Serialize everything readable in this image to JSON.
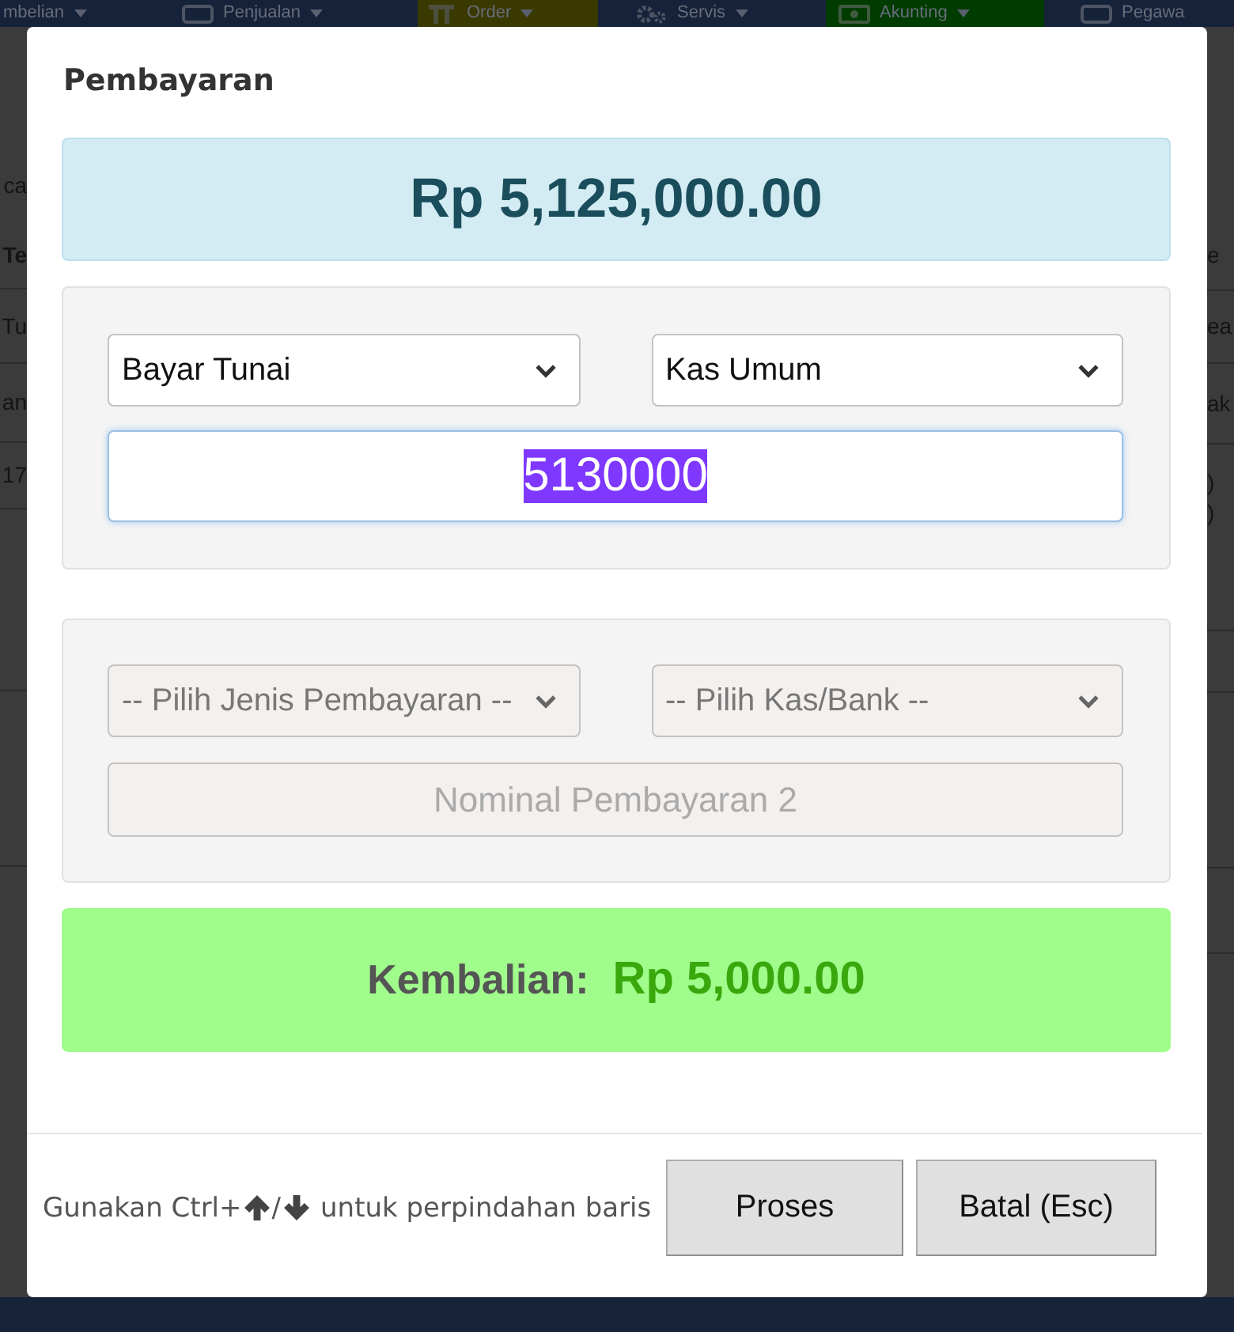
{
  "background": {
    "nav_items": [
      {
        "label": "mbelian",
        "kind": "plain",
        "has_caret": true
      },
      {
        "label": "Penjualan",
        "kind": "box",
        "has_caret": true
      },
      {
        "label": "Order",
        "kind": "bars",
        "has_caret": true,
        "color": "#3a3900"
      },
      {
        "label": "Servis",
        "kind": "gears",
        "has_caret": true
      },
      {
        "label": "Akunting",
        "kind": "money",
        "has_caret": true,
        "color": "#003b00"
      },
      {
        "label": "Pegawa",
        "kind": "box",
        "has_caret": false
      }
    ],
    "left_fragments": [
      {
        "text": "ca",
        "bold": false
      },
      {
        "text": "Te",
        "bold": true
      },
      {
        "text": "Tu",
        "bold": false
      },
      {
        "text": "an",
        "bold": false
      },
      {
        "text": "17",
        "bold": false
      }
    ],
    "right_fragments": [
      {
        "text": "e",
        "bold": false
      },
      {
        "text": "ea",
        "bold": false
      },
      {
        "text": "ak",
        "bold": false
      },
      {
        "text": ")",
        "bold": false
      },
      {
        "text": ")",
        "bold": false
      }
    ]
  },
  "dialog": {
    "title": "Pembayaran",
    "total": "Rp 5,125,000.00",
    "payments": [
      {
        "method": {
          "value": "Bayar Tunai",
          "disabled": false
        },
        "account": {
          "value": "Kas Umum",
          "disabled": false
        },
        "amount": {
          "value": "5130000",
          "disabled": false,
          "focused": true,
          "value_selected": true
        }
      },
      {
        "method": {
          "placeholder": "-- Pilih Jenis Pembayaran --",
          "disabled": true
        },
        "account": {
          "placeholder": "-- Pilih Kas/Bank --",
          "disabled": true
        },
        "amount": {
          "placeholder": "Nominal Pembayaran 2",
          "disabled": true,
          "focused": false
        }
      }
    ],
    "change": {
      "label": "Kembalian:",
      "amount": "Rp 5,000.00"
    },
    "hint": [
      {
        "kind": "text",
        "text": "Gunakan Ctrl+"
      },
      {
        "kind": "up_arrow"
      },
      {
        "kind": "text",
        "text": "/"
      },
      {
        "kind": "down_arrow"
      },
      {
        "kind": "text",
        "text": "untuk perpindahan baris"
      }
    ],
    "buttons": [
      {
        "label": "Proses"
      },
      {
        "label": "Batal (Esc)"
      }
    ]
  }
}
